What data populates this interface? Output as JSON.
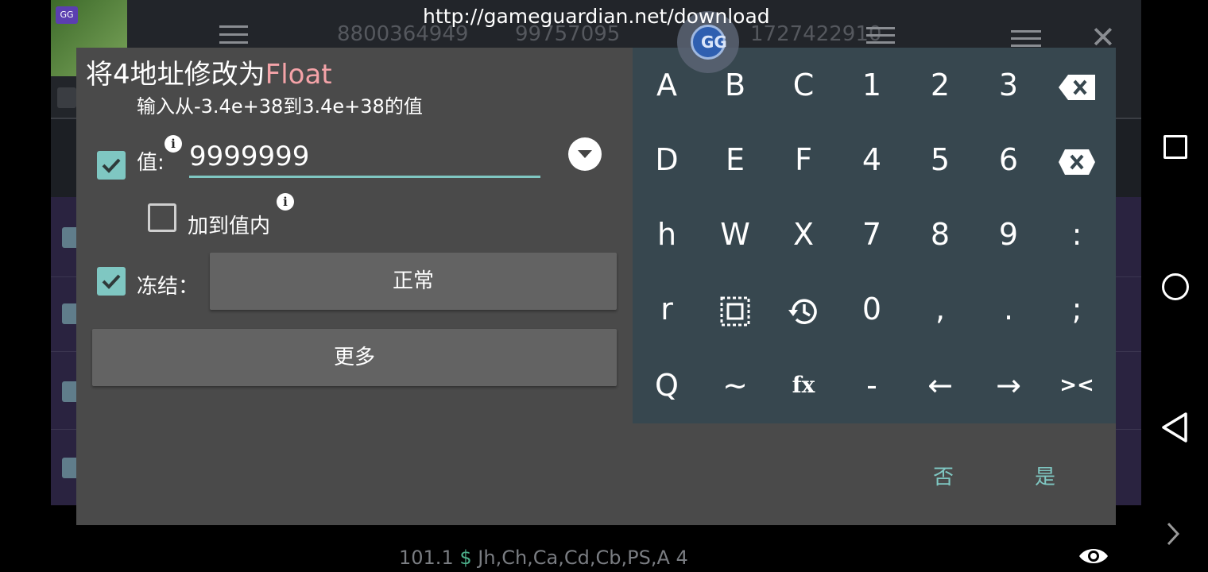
{
  "background": {
    "numbers": [
      "8800364949",
      "99757095",
      "1727422910"
    ],
    "bottom": {
      "value": "101.1",
      "symbol": "$",
      "regions": "Jh,Ch,Ca,Cd,Cb,PS,A",
      "count": "4"
    }
  },
  "url_overlay": "http://gameguardian.net/download",
  "dialog": {
    "title_prefix": "将4地址修改为",
    "title_type": "Float",
    "subtitle": "输入从-3.4e+38到3.4e+38的值",
    "value_label": "值:",
    "value": "9999999",
    "value_checked": true,
    "add_to_value_label": "加到值内",
    "add_to_value_checked": false,
    "freeze_label": "冻结：",
    "freeze_checked": true,
    "freeze_mode": "正常",
    "more_label": "更多",
    "no_label": "否",
    "yes_label": "是"
  },
  "keyboard": {
    "rows": [
      [
        "A",
        "B",
        "C",
        "1",
        "2",
        "3",
        "backspace-icon"
      ],
      [
        "D",
        "E",
        "F",
        "4",
        "5",
        "6",
        "clear-icon"
      ],
      [
        "h",
        "W",
        "X",
        "7",
        "8",
        "9",
        ":"
      ],
      [
        "r",
        "select-all-icon",
        "history-icon",
        "0",
        ",",
        ".",
        ";"
      ],
      [
        "Q",
        "~",
        "fx",
        "-",
        "←",
        "→",
        "><"
      ]
    ]
  },
  "icons": {
    "eye": "eye-icon",
    "nav": [
      "recents-square-icon",
      "home-circle-icon",
      "back-triangle-icon",
      "chevron-right-icon"
    ]
  },
  "colors": {
    "accent": "#7fc7c2",
    "title_type": "#f4a3a8",
    "keyboard_bg": "#37474f",
    "dialog_bg": "#4a4a4a"
  }
}
